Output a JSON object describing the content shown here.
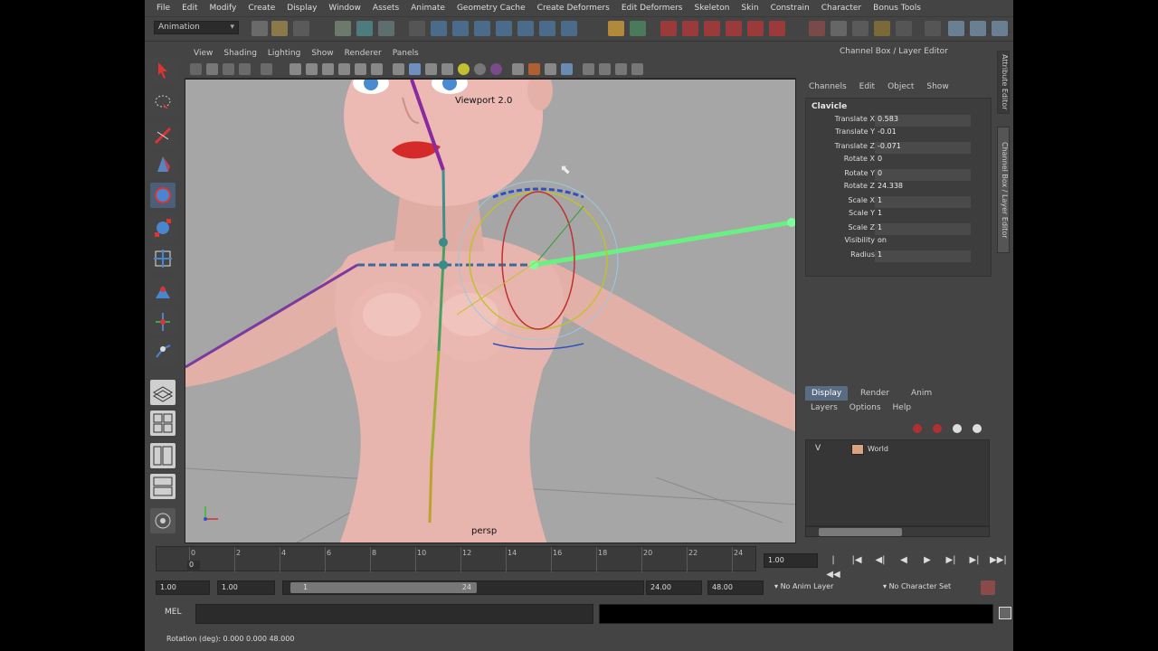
{
  "menubar": {
    "items": [
      "File",
      "Edit",
      "Modify",
      "Create",
      "Display",
      "Window",
      "Assets",
      "Animate",
      "Geometry Cache",
      "Create Deformers",
      "Edit Deformers",
      "Skeleton",
      "Skin",
      "Constrain",
      "Character",
      "Bonus Tools"
    ]
  },
  "statusline": {
    "mode": "Animation"
  },
  "panel": {
    "menus": [
      "View",
      "Shading",
      "Lighting",
      "Show",
      "Renderer",
      "Panels"
    ],
    "viewport_label": "Viewport 2.0",
    "camera_label": "persp"
  },
  "channel_box": {
    "header": "Channel Box / Layer Editor",
    "menus": [
      "Channels",
      "Edit",
      "Object",
      "Show"
    ],
    "object": "Clavicle",
    "attributes": [
      {
        "name": "Translate X",
        "value": "0.583"
      },
      {
        "name": "Translate Y",
        "value": "-0.01"
      },
      {
        "name": "Translate Z",
        "value": "-0.071"
      },
      {
        "name": "Rotate X",
        "value": "0"
      },
      {
        "name": "Rotate Y",
        "value": "0"
      },
      {
        "name": "Rotate Z",
        "value": "24.338"
      },
      {
        "name": "Scale X",
        "value": "1"
      },
      {
        "name": "Scale Y",
        "value": "1"
      },
      {
        "name": "Scale Z",
        "value": "1"
      },
      {
        "name": "Visibility",
        "value": "on"
      },
      {
        "name": "Radius",
        "value": "1"
      }
    ],
    "side_tabs": [
      "Attribute Editor",
      "Channel Box / Layer Editor"
    ]
  },
  "layer_editor": {
    "tabs": [
      "Display",
      "Render",
      "Anim"
    ],
    "active_tab": "Display",
    "menus": [
      "Layers",
      "Options",
      "Help"
    ],
    "layers": [
      {
        "visible": "V",
        "name": "World",
        "color": "#d7a383"
      }
    ]
  },
  "time_slider": {
    "ticks": [
      "0",
      "2",
      "4",
      "6",
      "8",
      "10",
      "12",
      "14",
      "16",
      "18",
      "20",
      "22",
      "24"
    ],
    "current_frame": "0",
    "current_time": "1.00"
  },
  "range_slider": {
    "start": "1.00",
    "playback_start": "1.00",
    "range_min": "1",
    "range_max": "24",
    "playback_end": "24.00",
    "end": "48.00",
    "anim_layer": "No Anim Layer",
    "character_set": "No Character Set"
  },
  "command_line": {
    "label": "MEL"
  },
  "help_line": {
    "text": "Rotation (deg):  0.000      0.000      48.000"
  },
  "colors": {
    "ui_bg": "#444444",
    "viewport_bg": "#a6a6a6",
    "skin": "#e7b5ad",
    "active_tab": "#5a6c84"
  }
}
